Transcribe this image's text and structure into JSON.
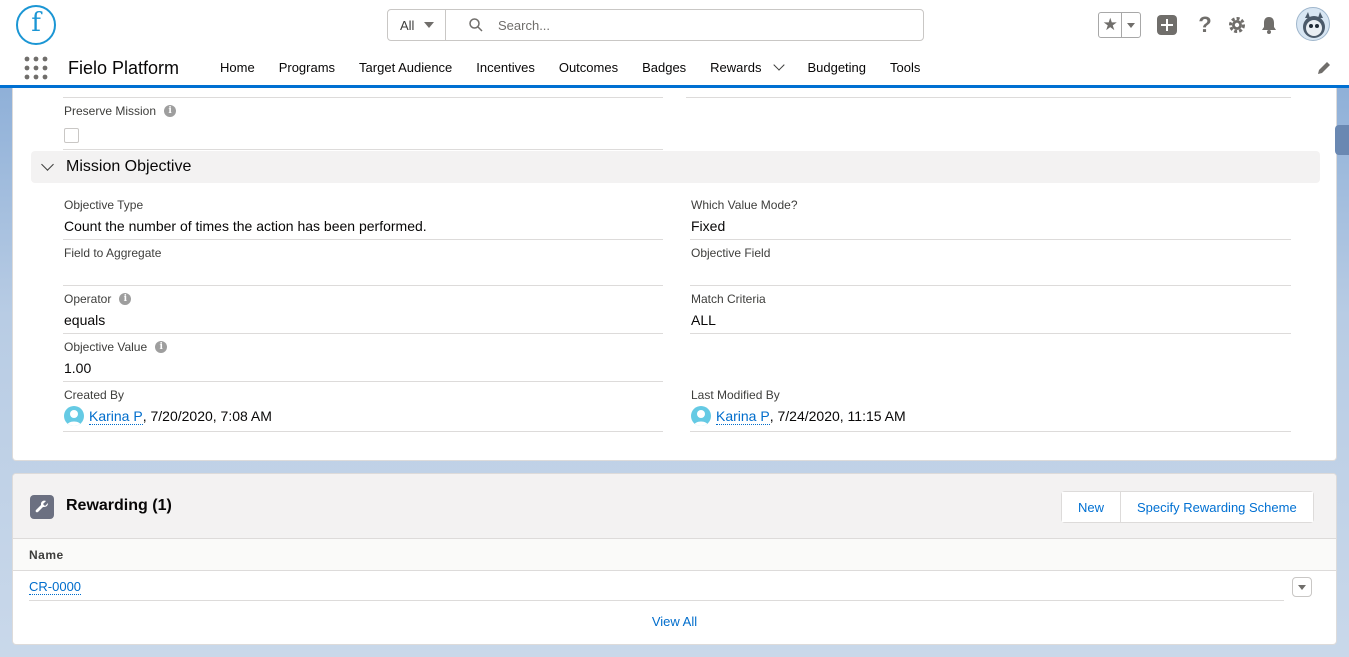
{
  "header": {
    "logo_letter": "f",
    "search_scope": "All",
    "search_placeholder": "Search..."
  },
  "nav": {
    "app_name": "Fielo Platform",
    "items": [
      {
        "label": "Home"
      },
      {
        "label": "Programs"
      },
      {
        "label": "Target Audience"
      },
      {
        "label": "Incentives"
      },
      {
        "label": "Outcomes"
      },
      {
        "label": "Badges"
      },
      {
        "label": "Rewards",
        "has_menu": true
      },
      {
        "label": "Budgeting"
      },
      {
        "label": "Tools"
      }
    ]
  },
  "detail": {
    "preserve_mission_label": "Preserve Mission",
    "preserve_mission_checked": false,
    "section_title": "Mission Objective",
    "fields": {
      "objective_type": {
        "label": "Objective Type",
        "value": "Count the number of times the action has been performed."
      },
      "which_value_mode": {
        "label": "Which Value Mode?",
        "value": "Fixed"
      },
      "field_to_aggregate": {
        "label": "Field to Aggregate",
        "value": ""
      },
      "objective_field": {
        "label": "Objective Field",
        "value": ""
      },
      "operator": {
        "label": "Operator",
        "value": "equals"
      },
      "match_criteria": {
        "label": "Match Criteria",
        "value": "ALL"
      },
      "objective_value": {
        "label": "Objective Value",
        "value": "1.00"
      },
      "created_by": {
        "label": "Created By",
        "user": "Karina P",
        "date": ", 7/20/2020, 7:08 AM"
      },
      "last_modified_by": {
        "label": "Last Modified By",
        "user": "Karina P",
        "date": ", 7/24/2020, 11:15 AM"
      }
    }
  },
  "related": {
    "title": "Rewarding (1)",
    "buttons": {
      "new": "New",
      "specify": "Specify Rewarding Scheme"
    },
    "column_name": "Name",
    "rows": [
      {
        "name": "CR-0000"
      }
    ],
    "view_all": "View All"
  },
  "colors": {
    "brand": "#0070d2",
    "link": "#006dcc"
  }
}
